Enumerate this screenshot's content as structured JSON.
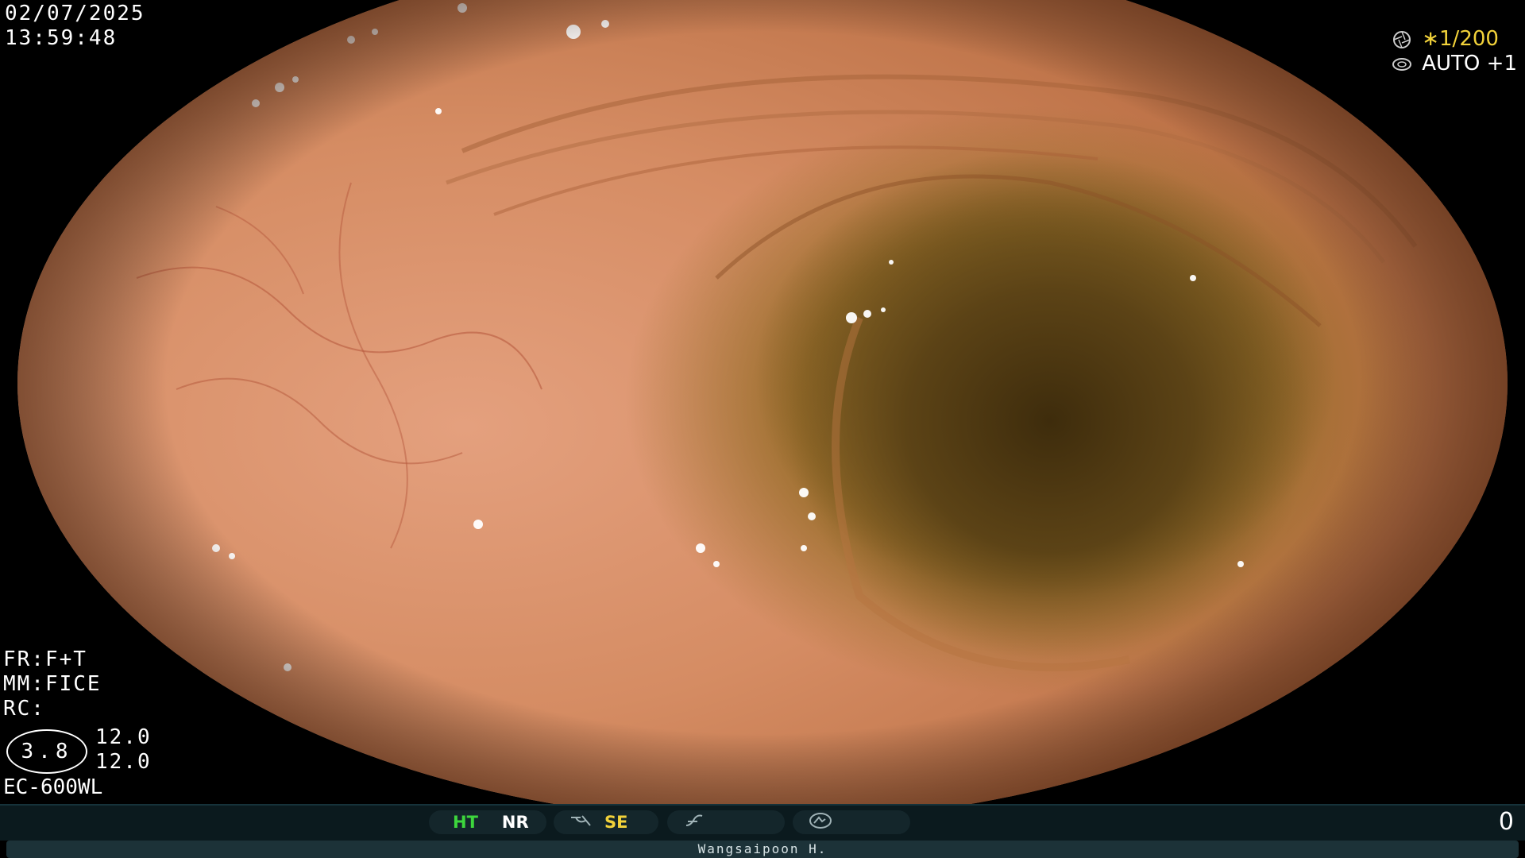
{
  "osd": {
    "date": "02/07/2025",
    "time": "13:59:48",
    "shutter": "∗1/200",
    "auto_exposure": "AUTO +1",
    "frame_mode": "FR:F+T",
    "mode": "MM:FICE",
    "rc": "RC:",
    "iris_value": "3.8",
    "enhance_1": "12.0",
    "enhance_2": "12.0",
    "scope_model": "EC-600WL",
    "icons": {
      "shutter": "aperture-icon",
      "auto": "exposure-icon"
    }
  },
  "statusbar": {
    "ht_label": "HT",
    "nr_label": "NR",
    "se_label": "SE",
    "counter": "0",
    "colors": {
      "ht": "#3dd63d",
      "se": "#f2d23a",
      "nr": "#ffffff"
    },
    "icons": [
      "structure-icon",
      "sharpness-icon",
      "capture-icon"
    ]
  },
  "operator": {
    "name": "Wangsaipoon H."
  }
}
